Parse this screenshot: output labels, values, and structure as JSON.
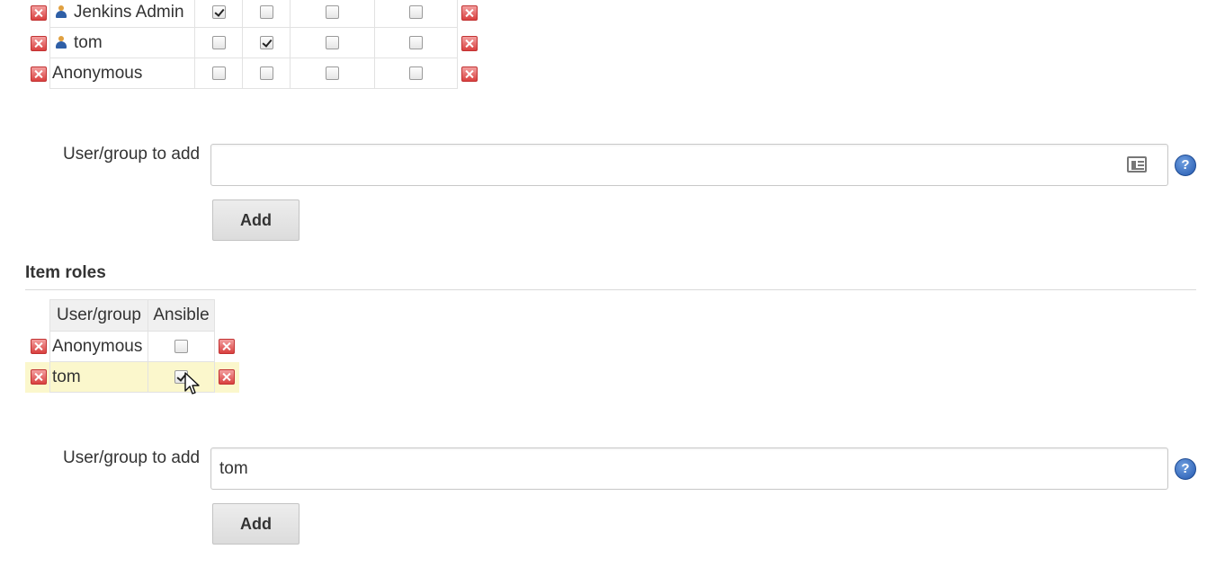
{
  "global_roles": {
    "rows": [
      {
        "name": "Jenkins Admin",
        "icon": "user-icon",
        "checks": [
          true,
          false,
          false,
          false
        ]
      },
      {
        "name": "tom",
        "icon": "user-icon",
        "checks": [
          false,
          true,
          false,
          false
        ]
      },
      {
        "name": "Anonymous",
        "icon": "",
        "checks": [
          false,
          false,
          false,
          false
        ]
      }
    ]
  },
  "global_add": {
    "label": "User/group to add",
    "value": "",
    "button": "Add",
    "help": "?"
  },
  "item_roles": {
    "title": "Item roles",
    "columns": [
      "User/group",
      "Ansible"
    ],
    "rows": [
      {
        "name": "Anonymous",
        "checked": false
      },
      {
        "name": "tom",
        "checked": true
      }
    ]
  },
  "item_add": {
    "label": "User/group to add",
    "value": "tom",
    "button": "Add",
    "help": "?"
  },
  "colors": {
    "delete": "#d9403f",
    "highlight_row": "#fbf7cc",
    "help": "#2459b0"
  }
}
